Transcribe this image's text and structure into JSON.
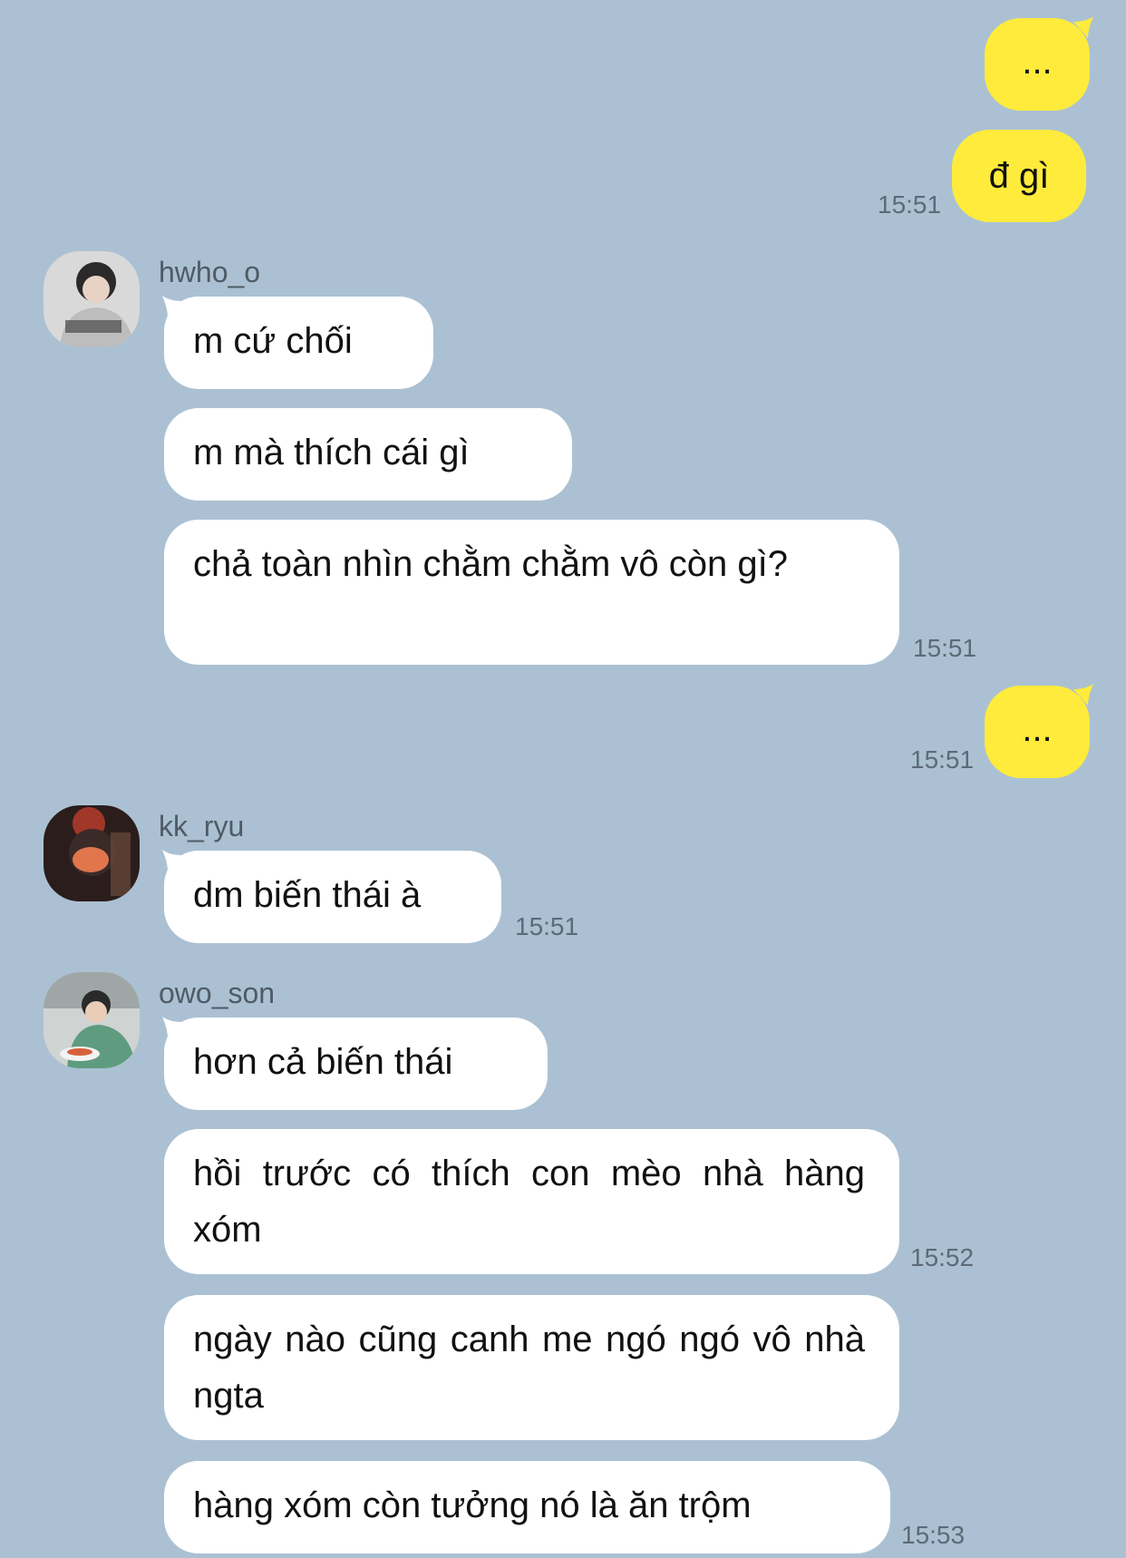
{
  "messages": {
    "m1": {
      "text": "..."
    },
    "m2": {
      "text": "đ gì",
      "time": "15:51"
    },
    "g1": {
      "sender": "hwho_o",
      "b1": "m cứ chối",
      "b2": "m mà thích cái gì",
      "b3": "chả toàn nhìn chằm chằm vô còn gì?",
      "time": "15:51"
    },
    "m3": {
      "text": "...",
      "time": "15:51"
    },
    "g2": {
      "sender": "kk_ryu",
      "b1": "dm biến thái à",
      "time": "15:51"
    },
    "g3": {
      "sender": "owo_son",
      "b1": "hơn cả biến thái",
      "b2": "hồi trước có thích con mèo nhà hàng xóm",
      "b2_time": "15:52",
      "b3": "ngày nào cũng canh me ngó ngó vô nhà ngta",
      "b4": "hàng xóm còn tưởng nó là ăn trộm",
      "b4_time": "15:53"
    }
  },
  "colors": {
    "background": "#abc1d3",
    "outgoing_bubble": "#ffeb3b",
    "incoming_bubble": "#ffffff"
  }
}
